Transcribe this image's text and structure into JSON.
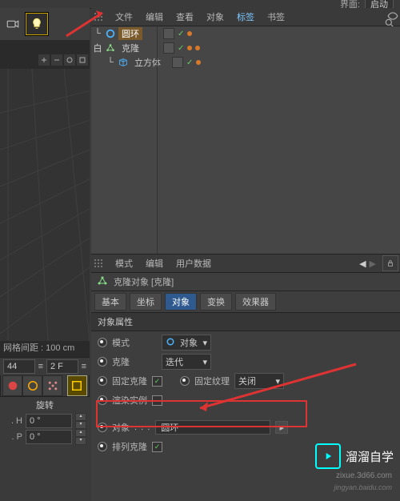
{
  "top": {
    "interface_label": "界面:",
    "layout_preset": "启动"
  },
  "object_menu": {
    "file": "文件",
    "edit": "编辑",
    "view": "查看",
    "object": "对象",
    "tags": "标签",
    "bookmarks": "书签"
  },
  "tree": {
    "items": [
      {
        "name": "圆环",
        "selected": true,
        "indent": 0,
        "icon": "ring"
      },
      {
        "name": "克隆",
        "selected": false,
        "indent": 0,
        "icon": "cloner"
      },
      {
        "name": "立方体",
        "selected": false,
        "indent": 1,
        "icon": "cube"
      }
    ]
  },
  "attr_menu": {
    "mode": "模式",
    "edit": "编辑",
    "userdata": "用户数据"
  },
  "attr_title": "克隆对象 [克隆]",
  "tabs": {
    "basic": "基本",
    "coord": "坐标",
    "object": "对象",
    "transform": "变换",
    "effector": "效果器"
  },
  "section_header": "对象属性",
  "props": {
    "mode_label": "模式",
    "mode_value": "对象",
    "clone_label": "克隆",
    "clone_value": "迭代",
    "fixed_clone_label": "固定克隆",
    "fixed_texture_label": "固定纹理",
    "fixed_texture_value": "关闭",
    "render_instance_label": "渲染实例",
    "object_label": "对象",
    "object_dots": ". . .",
    "object_value": "圆环",
    "array_clone_label": "排列克隆"
  },
  "viewport": {
    "hud": "网格间距 : 100 cm"
  },
  "bottom": {
    "frame": "44",
    "fps": "2 F",
    "rotate_label": "旋转",
    "h_label": ". H",
    "h_value": "0 °",
    "p_label": ". P",
    "p_value": "0 °"
  },
  "watermark": {
    "text": "溜溜自学",
    "url": "zixue.3d66.com",
    "src": "jingyan.baidu.com"
  }
}
